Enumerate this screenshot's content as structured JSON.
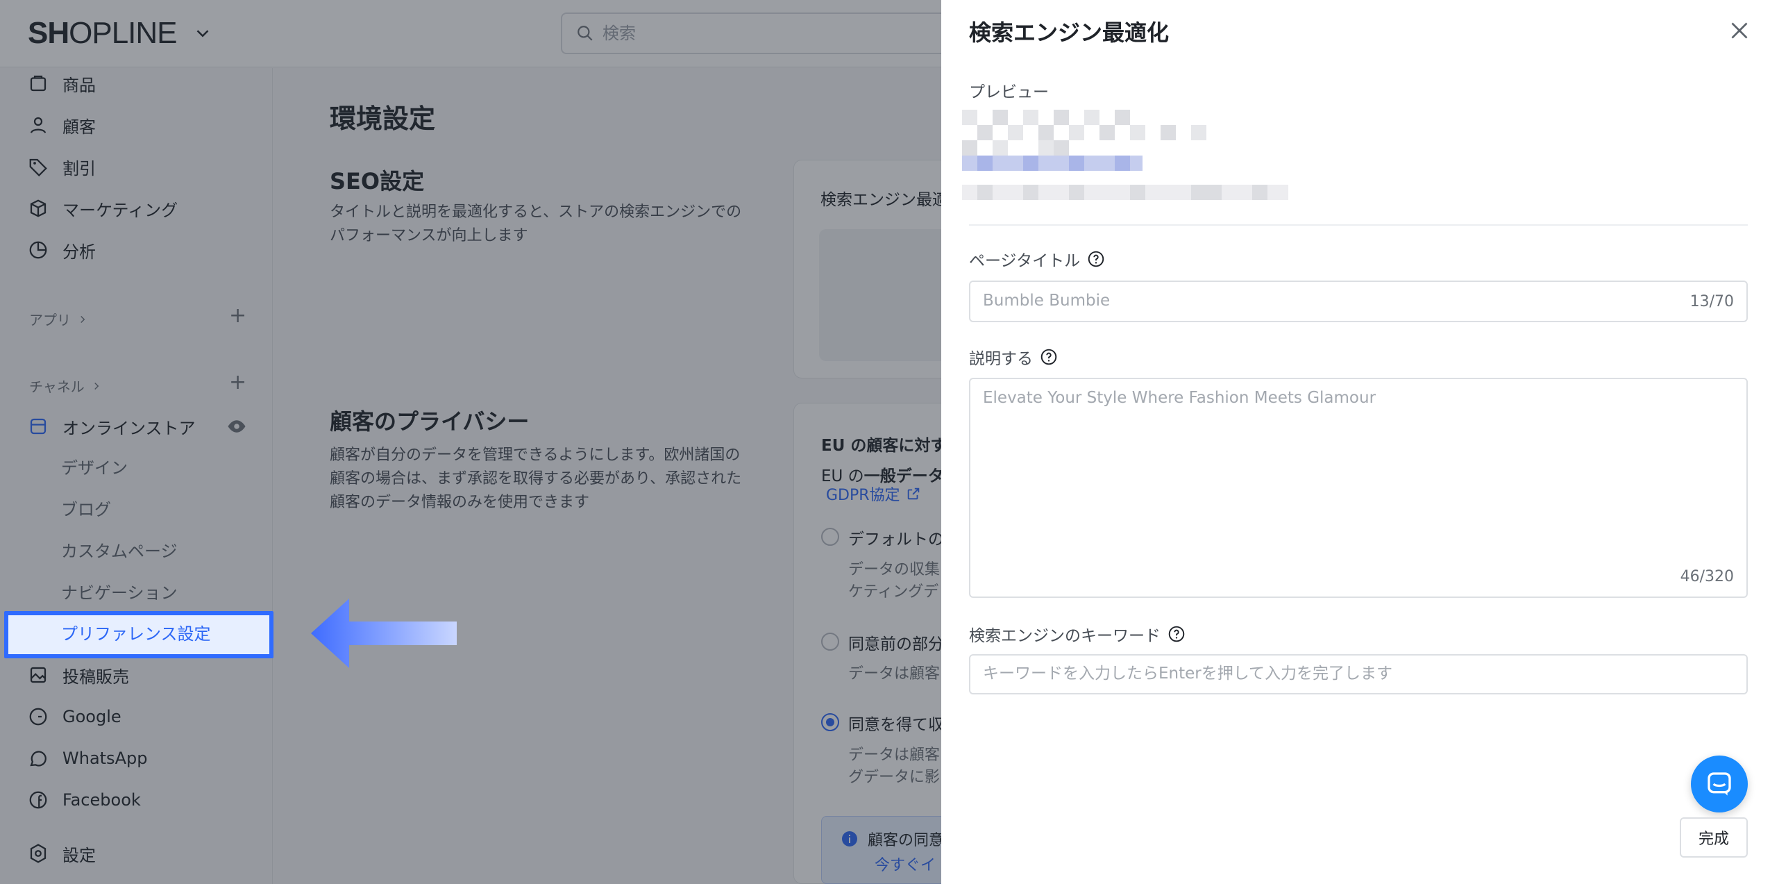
{
  "app": {
    "brand": "SHOPLINE",
    "search_placeholder": "検索"
  },
  "sidebar": {
    "items": [
      {
        "label": "商品",
        "icon": "bag-icon"
      },
      {
        "label": "顧客",
        "icon": "person-icon"
      },
      {
        "label": "割引",
        "icon": "tag-icon"
      },
      {
        "label": "マーケティング",
        "icon": "cube-icon"
      },
      {
        "label": "分析",
        "icon": "pie-chart-icon"
      }
    ],
    "apps_label": "アプリ",
    "channels_label": "チャネル",
    "online_store": "オンラインストア",
    "online_store_sub": [
      "デザイン",
      "ブログ",
      "カスタムページ",
      "ナビゲーション",
      "プリファレンス設定"
    ],
    "channels": [
      {
        "label": "投稿販売",
        "icon": "image-icon"
      },
      {
        "label": "Google",
        "icon": "google-icon"
      },
      {
        "label": "WhatsApp",
        "icon": "whatsapp-icon"
      },
      {
        "label": "Facebook",
        "icon": "facebook-icon"
      }
    ],
    "settings": "設定"
  },
  "main": {
    "title": "環境設定",
    "seo": {
      "heading": "SEO設定",
      "description_lines": [
        "タイトルと説明を最適化すると、ストアの検索エンジンでの",
        "パフォーマンスが向上します"
      ],
      "card_title": "検索エンジン最適"
    },
    "privacy": {
      "heading": "顧客のプライバシー",
      "description_lines": [
        "顧客が自分のデータを管理できるようにします。欧州諸国の",
        "顧客の場合は、まず承認を取得する必要があり、承認された",
        "顧客のデータ情報のみを使用できます"
      ],
      "card_title": "EU の顧客に対す",
      "card_sub_prefix": "EU の",
      "card_sub_bold": "一般データ",
      "gdpr_link": "GDPR協定",
      "options": [
        {
          "label": "デフォルトの",
          "desc": [
            "データの収集",
            "ケティングデ"
          ],
          "checked": false
        },
        {
          "label": "同意前の部分",
          "desc": [
            "データは顧客"
          ],
          "checked": false
        },
        {
          "label": "同意を得て収",
          "desc": [
            "データは顧客",
            "グデータに影"
          ],
          "checked": true
        }
      ],
      "info_lines": [
        "顧客の同意",
        "今すぐイ"
      ]
    }
  },
  "drawer": {
    "title": "検索エンジン最適化",
    "preview_label": "プレビュー",
    "page_title_label": "ページタイトル",
    "page_title_placeholder": "Bumble Bumbie",
    "page_title_counter": "13/70",
    "description_label": "説明する",
    "description_placeholder": "Elevate Your Style Where Fashion Meets Glamour",
    "description_counter": "46/320",
    "keywords_label": "検索エンジンのキーワード",
    "keywords_placeholder": "キーワードを入力したらEnterを押して入力を完了します",
    "done_label": "完成"
  },
  "colors": {
    "accent": "#2b66f6",
    "highlight_border": "#2f6bff",
    "chat_fab": "#1a8cff"
  }
}
